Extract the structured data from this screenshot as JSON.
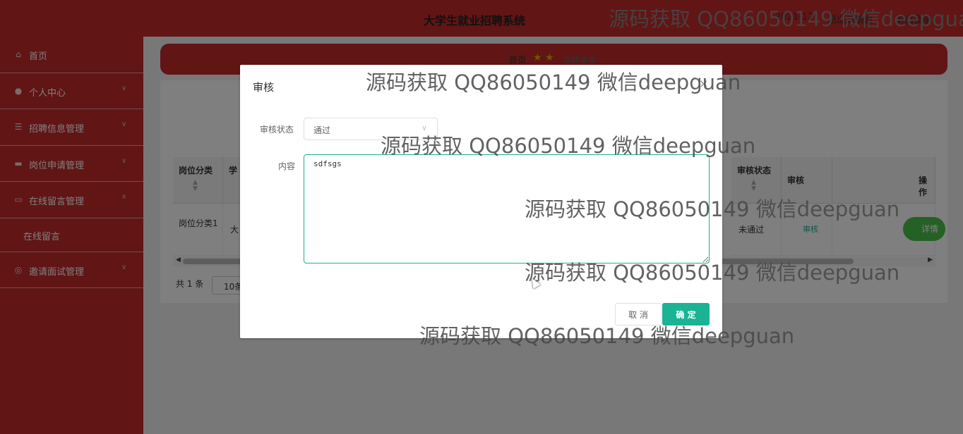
{
  "header": {
    "title": "大学生就业招聘系统",
    "user": "2021-12",
    "logout": "退出到前台",
    "exit": "退出登录"
  },
  "sidebar": {
    "items": [
      {
        "label": "首页",
        "icon": "home-icon"
      },
      {
        "label": "个人中心",
        "icon": "user-icon"
      },
      {
        "label": "招聘信息管理",
        "icon": "list-icon"
      },
      {
        "label": "岗位申请管理",
        "icon": "chat-icon"
      },
      {
        "label": "在线留言管理",
        "icon": "message-icon"
      },
      {
        "label": "邀请面试管理",
        "icon": "compass-icon"
      }
    ],
    "submenu": {
      "label": "在线留言"
    }
  },
  "breadcrumb": {
    "home": "首页",
    "stars": "★ ★",
    "current": "在线留言"
  },
  "table": {
    "headers": [
      "岗位分类",
      "学",
      "审核状态",
      "审核",
      "操作"
    ],
    "row": {
      "category": "岗位分类1",
      "school": "大",
      "status": "未通过",
      "audit": "审核",
      "detail": "详情"
    }
  },
  "pager": {
    "total": "共 1 条",
    "size": "10条"
  },
  "dialog": {
    "title": "审核",
    "close": "×",
    "status_label": "审核状态",
    "status_value": "通过",
    "content_label": "内容",
    "content_value": "sdfsgs",
    "cancel": "取 消",
    "ok": "确 定"
  },
  "watermark": "源码获取 QQ86050149 微信deepguan",
  "colors": {
    "primary": "#c22a2a",
    "accent": "#1ab394",
    "detail": "#4bc04b"
  }
}
